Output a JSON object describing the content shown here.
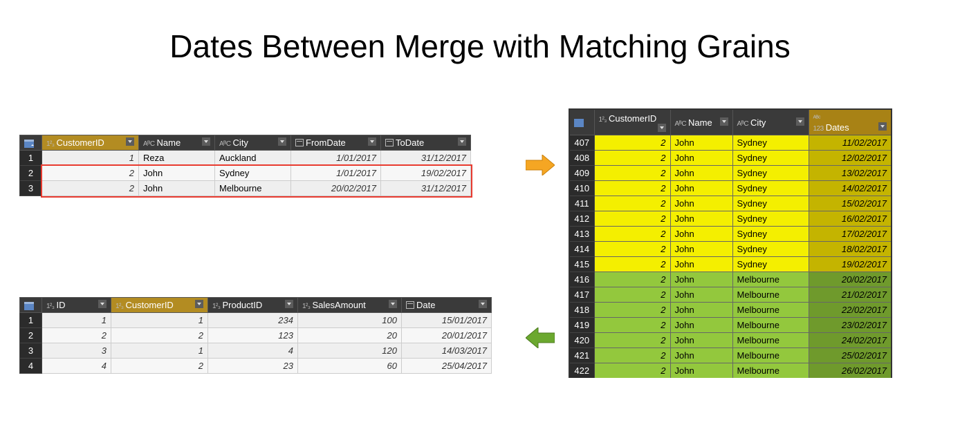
{
  "title": "Dates Between Merge with Matching Grains",
  "typeLabels": {
    "int": "1²₃",
    "text": "AᴮC"
  },
  "customers": {
    "columns": [
      "CustomerID",
      "Name",
      "City",
      "FromDate",
      "ToDate"
    ],
    "rows": [
      {
        "CustomerID": "1",
        "Name": "Reza",
        "City": "Auckland",
        "FromDate": "1/01/2017",
        "ToDate": "31/12/2017"
      },
      {
        "CustomerID": "2",
        "Name": "John",
        "City": "Sydney",
        "FromDate": "1/01/2017",
        "ToDate": "19/02/2017"
      },
      {
        "CustomerID": "2",
        "Name": "John",
        "City": "Melbourne",
        "FromDate": "20/02/2017",
        "ToDate": "31/12/2017"
      }
    ]
  },
  "sales": {
    "columns": [
      "ID",
      "CustomerID",
      "ProductID",
      "SalesAmount",
      "Date"
    ],
    "rows": [
      {
        "ID": "1",
        "CustomerID": "1",
        "ProductID": "234",
        "SalesAmount": "100",
        "Date": "15/01/2017"
      },
      {
        "ID": "2",
        "CustomerID": "2",
        "ProductID": "123",
        "SalesAmount": "20",
        "Date": "20/01/2017"
      },
      {
        "ID": "3",
        "CustomerID": "1",
        "ProductID": "4",
        "SalesAmount": "120",
        "Date": "14/03/2017"
      },
      {
        "ID": "4",
        "CustomerID": "2",
        "ProductID": "23",
        "SalesAmount": "60",
        "Date": "25/04/2017"
      }
    ]
  },
  "expanded": {
    "columns": [
      "CustomerID",
      "Name",
      "City",
      "Dates"
    ],
    "rows": [
      {
        "row": "407",
        "CustomerID": "2",
        "Name": "John",
        "City": "Sydney",
        "Dates": "11/02/2017",
        "hl": "yellow"
      },
      {
        "row": "408",
        "CustomerID": "2",
        "Name": "John",
        "City": "Sydney",
        "Dates": "12/02/2017",
        "hl": "yellow"
      },
      {
        "row": "409",
        "CustomerID": "2",
        "Name": "John",
        "City": "Sydney",
        "Dates": "13/02/2017",
        "hl": "yellow"
      },
      {
        "row": "410",
        "CustomerID": "2",
        "Name": "John",
        "City": "Sydney",
        "Dates": "14/02/2017",
        "hl": "yellow"
      },
      {
        "row": "411",
        "CustomerID": "2",
        "Name": "John",
        "City": "Sydney",
        "Dates": "15/02/2017",
        "hl": "yellow"
      },
      {
        "row": "412",
        "CustomerID": "2",
        "Name": "John",
        "City": "Sydney",
        "Dates": "16/02/2017",
        "hl": "yellow"
      },
      {
        "row": "413",
        "CustomerID": "2",
        "Name": "John",
        "City": "Sydney",
        "Dates": "17/02/2017",
        "hl": "yellow"
      },
      {
        "row": "414",
        "CustomerID": "2",
        "Name": "John",
        "City": "Sydney",
        "Dates": "18/02/2017",
        "hl": "yellow"
      },
      {
        "row": "415",
        "CustomerID": "2",
        "Name": "John",
        "City": "Sydney",
        "Dates": "19/02/2017",
        "hl": "yellow"
      },
      {
        "row": "416",
        "CustomerID": "2",
        "Name": "John",
        "City": "Melbourne",
        "Dates": "20/02/2017",
        "hl": "green"
      },
      {
        "row": "417",
        "CustomerID": "2",
        "Name": "John",
        "City": "Melbourne",
        "Dates": "21/02/2017",
        "hl": "green"
      },
      {
        "row": "418",
        "CustomerID": "2",
        "Name": "John",
        "City": "Melbourne",
        "Dates": "22/02/2017",
        "hl": "green"
      },
      {
        "row": "419",
        "CustomerID": "2",
        "Name": "John",
        "City": "Melbourne",
        "Dates": "23/02/2017",
        "hl": "green"
      },
      {
        "row": "420",
        "CustomerID": "2",
        "Name": "John",
        "City": "Melbourne",
        "Dates": "24/02/2017",
        "hl": "green"
      },
      {
        "row": "421",
        "CustomerID": "2",
        "Name": "John",
        "City": "Melbourne",
        "Dates": "25/02/2017",
        "hl": "green"
      },
      {
        "row": "422",
        "CustomerID": "2",
        "Name": "John",
        "City": "Melbourne",
        "Dates": "26/02/2017",
        "hl": "green",
        "cut": true
      }
    ]
  }
}
